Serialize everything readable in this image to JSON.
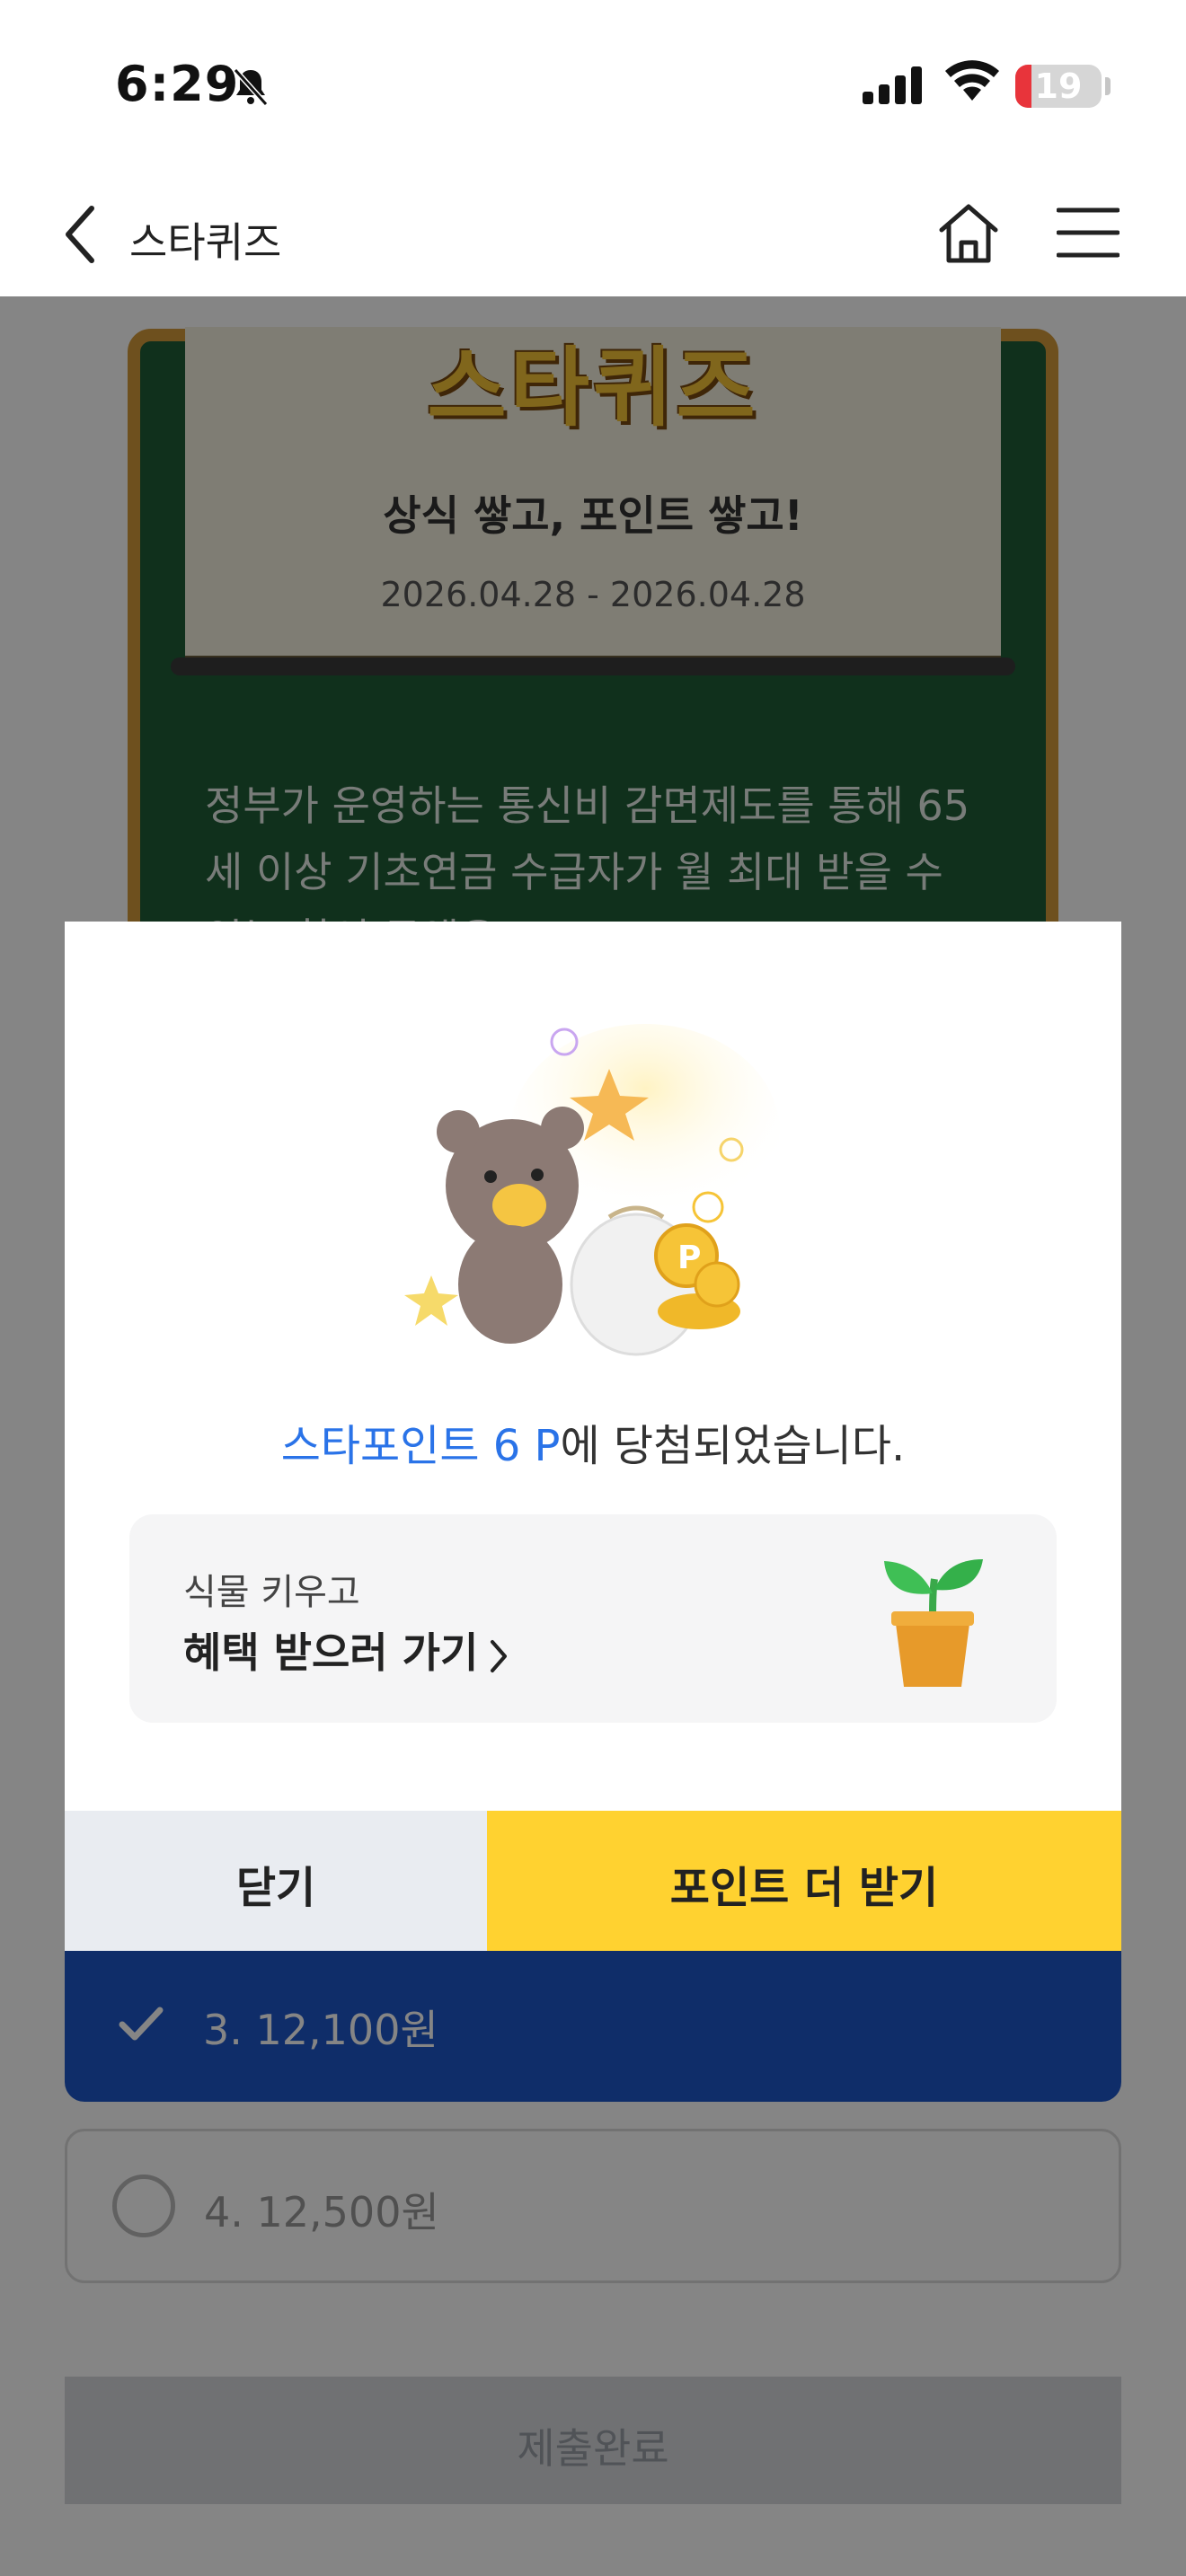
{
  "status_bar": {
    "time": "6:29",
    "battery": "19",
    "battery_fraction": 0.19
  },
  "nav": {
    "title": "스타퀴즈",
    "icons": [
      "back-icon",
      "home-icon",
      "menu-icon"
    ]
  },
  "quiz": {
    "logo": "스타퀴즈",
    "subtitle": "상식 쌓고, 포인트 쌓고!",
    "date": "2026.04.28 - 2026.04.28",
    "question": "정부가 운영하는 통신비 감면제도를 통해 65세 이상 기초연금 수급자가 월 최대 받을 수 있는 할인 금액은"
  },
  "answers": [
    {
      "label": "3. 12,100원",
      "selected": true
    },
    {
      "label": "4. 12,500원",
      "selected": false
    }
  ],
  "submit": {
    "label": "제출완료"
  },
  "modal": {
    "result_highlight": "스타포인트 6 P",
    "result_rest": "에 당첨되었습니다.",
    "benefit": {
      "sub": "식물 키우고",
      "main": "혜택 받으러 가기"
    },
    "close_label": "닫기",
    "more_label": "포인트 더 받기"
  },
  "colors": {
    "accent_blue": "#2a73e8",
    "selected_answer": "#1d56c9",
    "more_button": "#ffd230",
    "close_button": "#e9ecf1",
    "board_green": "#1f5c37"
  }
}
